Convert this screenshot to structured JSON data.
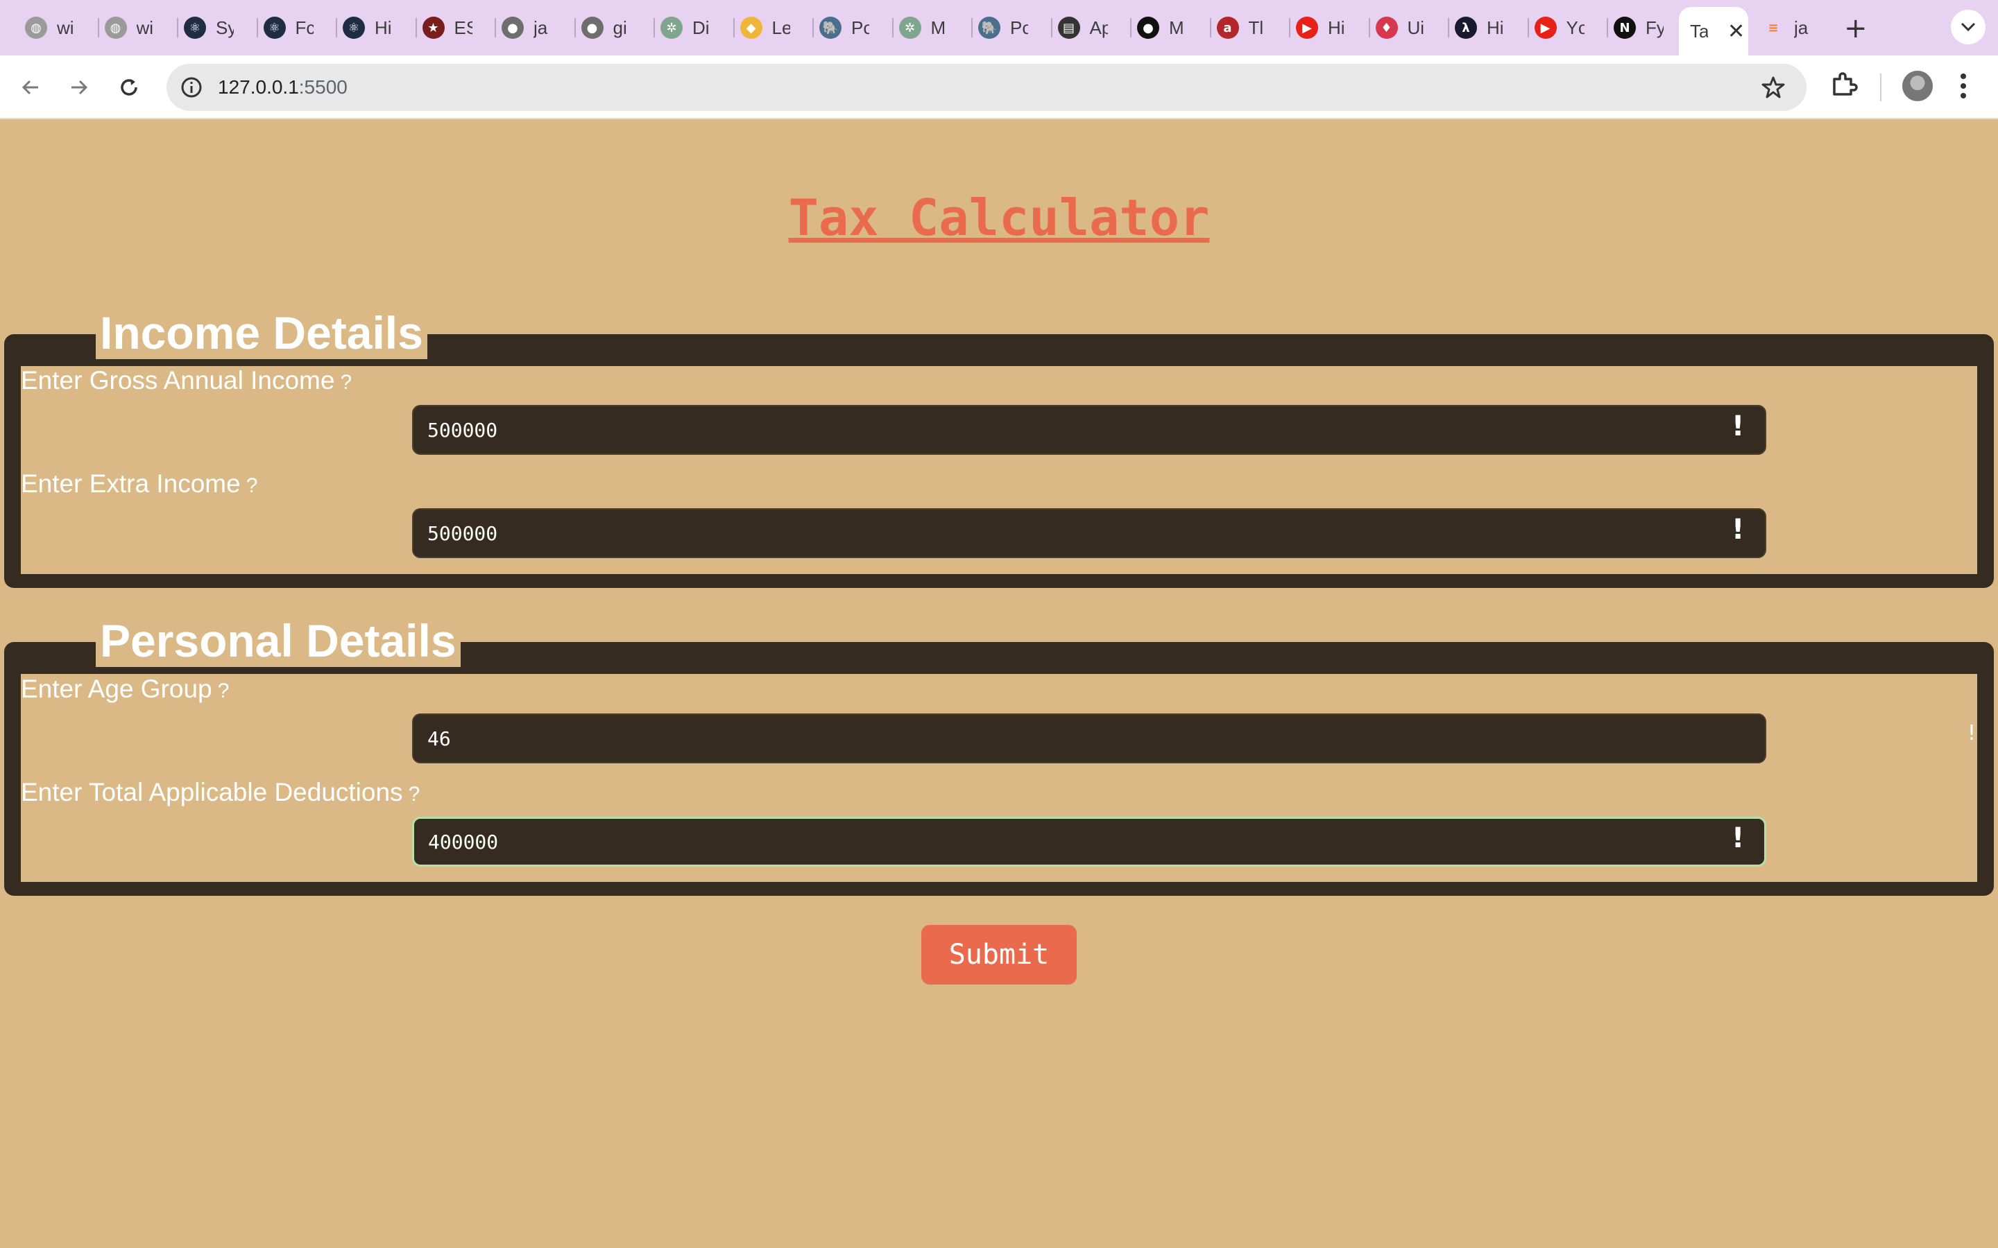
{
  "browser": {
    "tabs": [
      {
        "label": "wi",
        "icon": "web-icon",
        "color": "#9a9a9a"
      },
      {
        "label": "wi",
        "icon": "web-icon",
        "color": "#9a9a9a"
      },
      {
        "label": "Sy",
        "icon": "react-icon",
        "color": "#1f2d44"
      },
      {
        "label": "Fc",
        "icon": "react-icon",
        "color": "#1f2d44"
      },
      {
        "label": "Hi",
        "icon": "react-icon",
        "color": "#1f2d44"
      },
      {
        "label": "ES",
        "icon": "star-icon",
        "color": "#7a1d1d"
      },
      {
        "label": "ja",
        "icon": "github-icon",
        "color": "#6e6e6e"
      },
      {
        "label": "gi",
        "icon": "github-icon",
        "color": "#6e6e6e"
      },
      {
        "label": "Di",
        "icon": "openai-icon",
        "color": "#7fa58f"
      },
      {
        "label": "Le",
        "icon": "leetcode-icon",
        "color": "#f0b63a"
      },
      {
        "label": "Pc",
        "icon": "postgres-icon",
        "color": "#4a6e8c"
      },
      {
        "label": "M",
        "icon": "openai-icon",
        "color": "#7fa58f"
      },
      {
        "label": "Pc",
        "icon": "postgres-icon",
        "color": "#4a6e8c"
      },
      {
        "label": "Ap",
        "icon": "doc-icon",
        "color": "#333333"
      },
      {
        "label": "M",
        "icon": "github-icon",
        "color": "#111111"
      },
      {
        "label": "Tl",
        "icon": "a-icon",
        "color": "#b3262c"
      },
      {
        "label": "Hi",
        "icon": "youtube-icon",
        "color": "#e62117"
      },
      {
        "label": "Ui",
        "icon": "udemy-icon",
        "color": "#d6394d"
      },
      {
        "label": "Hi",
        "icon": "lambda-icon",
        "color": "#1a1a2e"
      },
      {
        "label": "Yc",
        "icon": "youtube-icon",
        "color": "#e62117"
      },
      {
        "label": "Fy",
        "icon": "notion-icon",
        "color": "#111111"
      }
    ],
    "active_tab": {
      "label": "Ta"
    },
    "last_tab": {
      "label": "ja",
      "icon": "stackoverflow-icon",
      "color": "#f48024"
    },
    "url_host": "127.0.0.1",
    "url_port": ":5500"
  },
  "page": {
    "title": "Tax Calculator",
    "sections": [
      {
        "legend": "Income Details",
        "fields": [
          {
            "label": "Enter Gross Annual Income",
            "help": "?",
            "value": "500000",
            "warn": "!"
          },
          {
            "label": "Enter Extra Income",
            "help": "?",
            "value": "500000",
            "warn": "!"
          }
        ]
      },
      {
        "legend": "Personal Details",
        "fields": [
          {
            "label": "Enter Age Group",
            "help": "?",
            "value": "46",
            "warn": "!"
          },
          {
            "label": "Enter Total Applicable Deductions",
            "help": "?",
            "value": "400000",
            "warn": "!"
          }
        ]
      }
    ],
    "submit_label": "Submit"
  },
  "colors": {
    "background": "#dab987",
    "panel": "#362b20",
    "accent": "#ea6a4d",
    "focus": "#b6e0a6"
  }
}
